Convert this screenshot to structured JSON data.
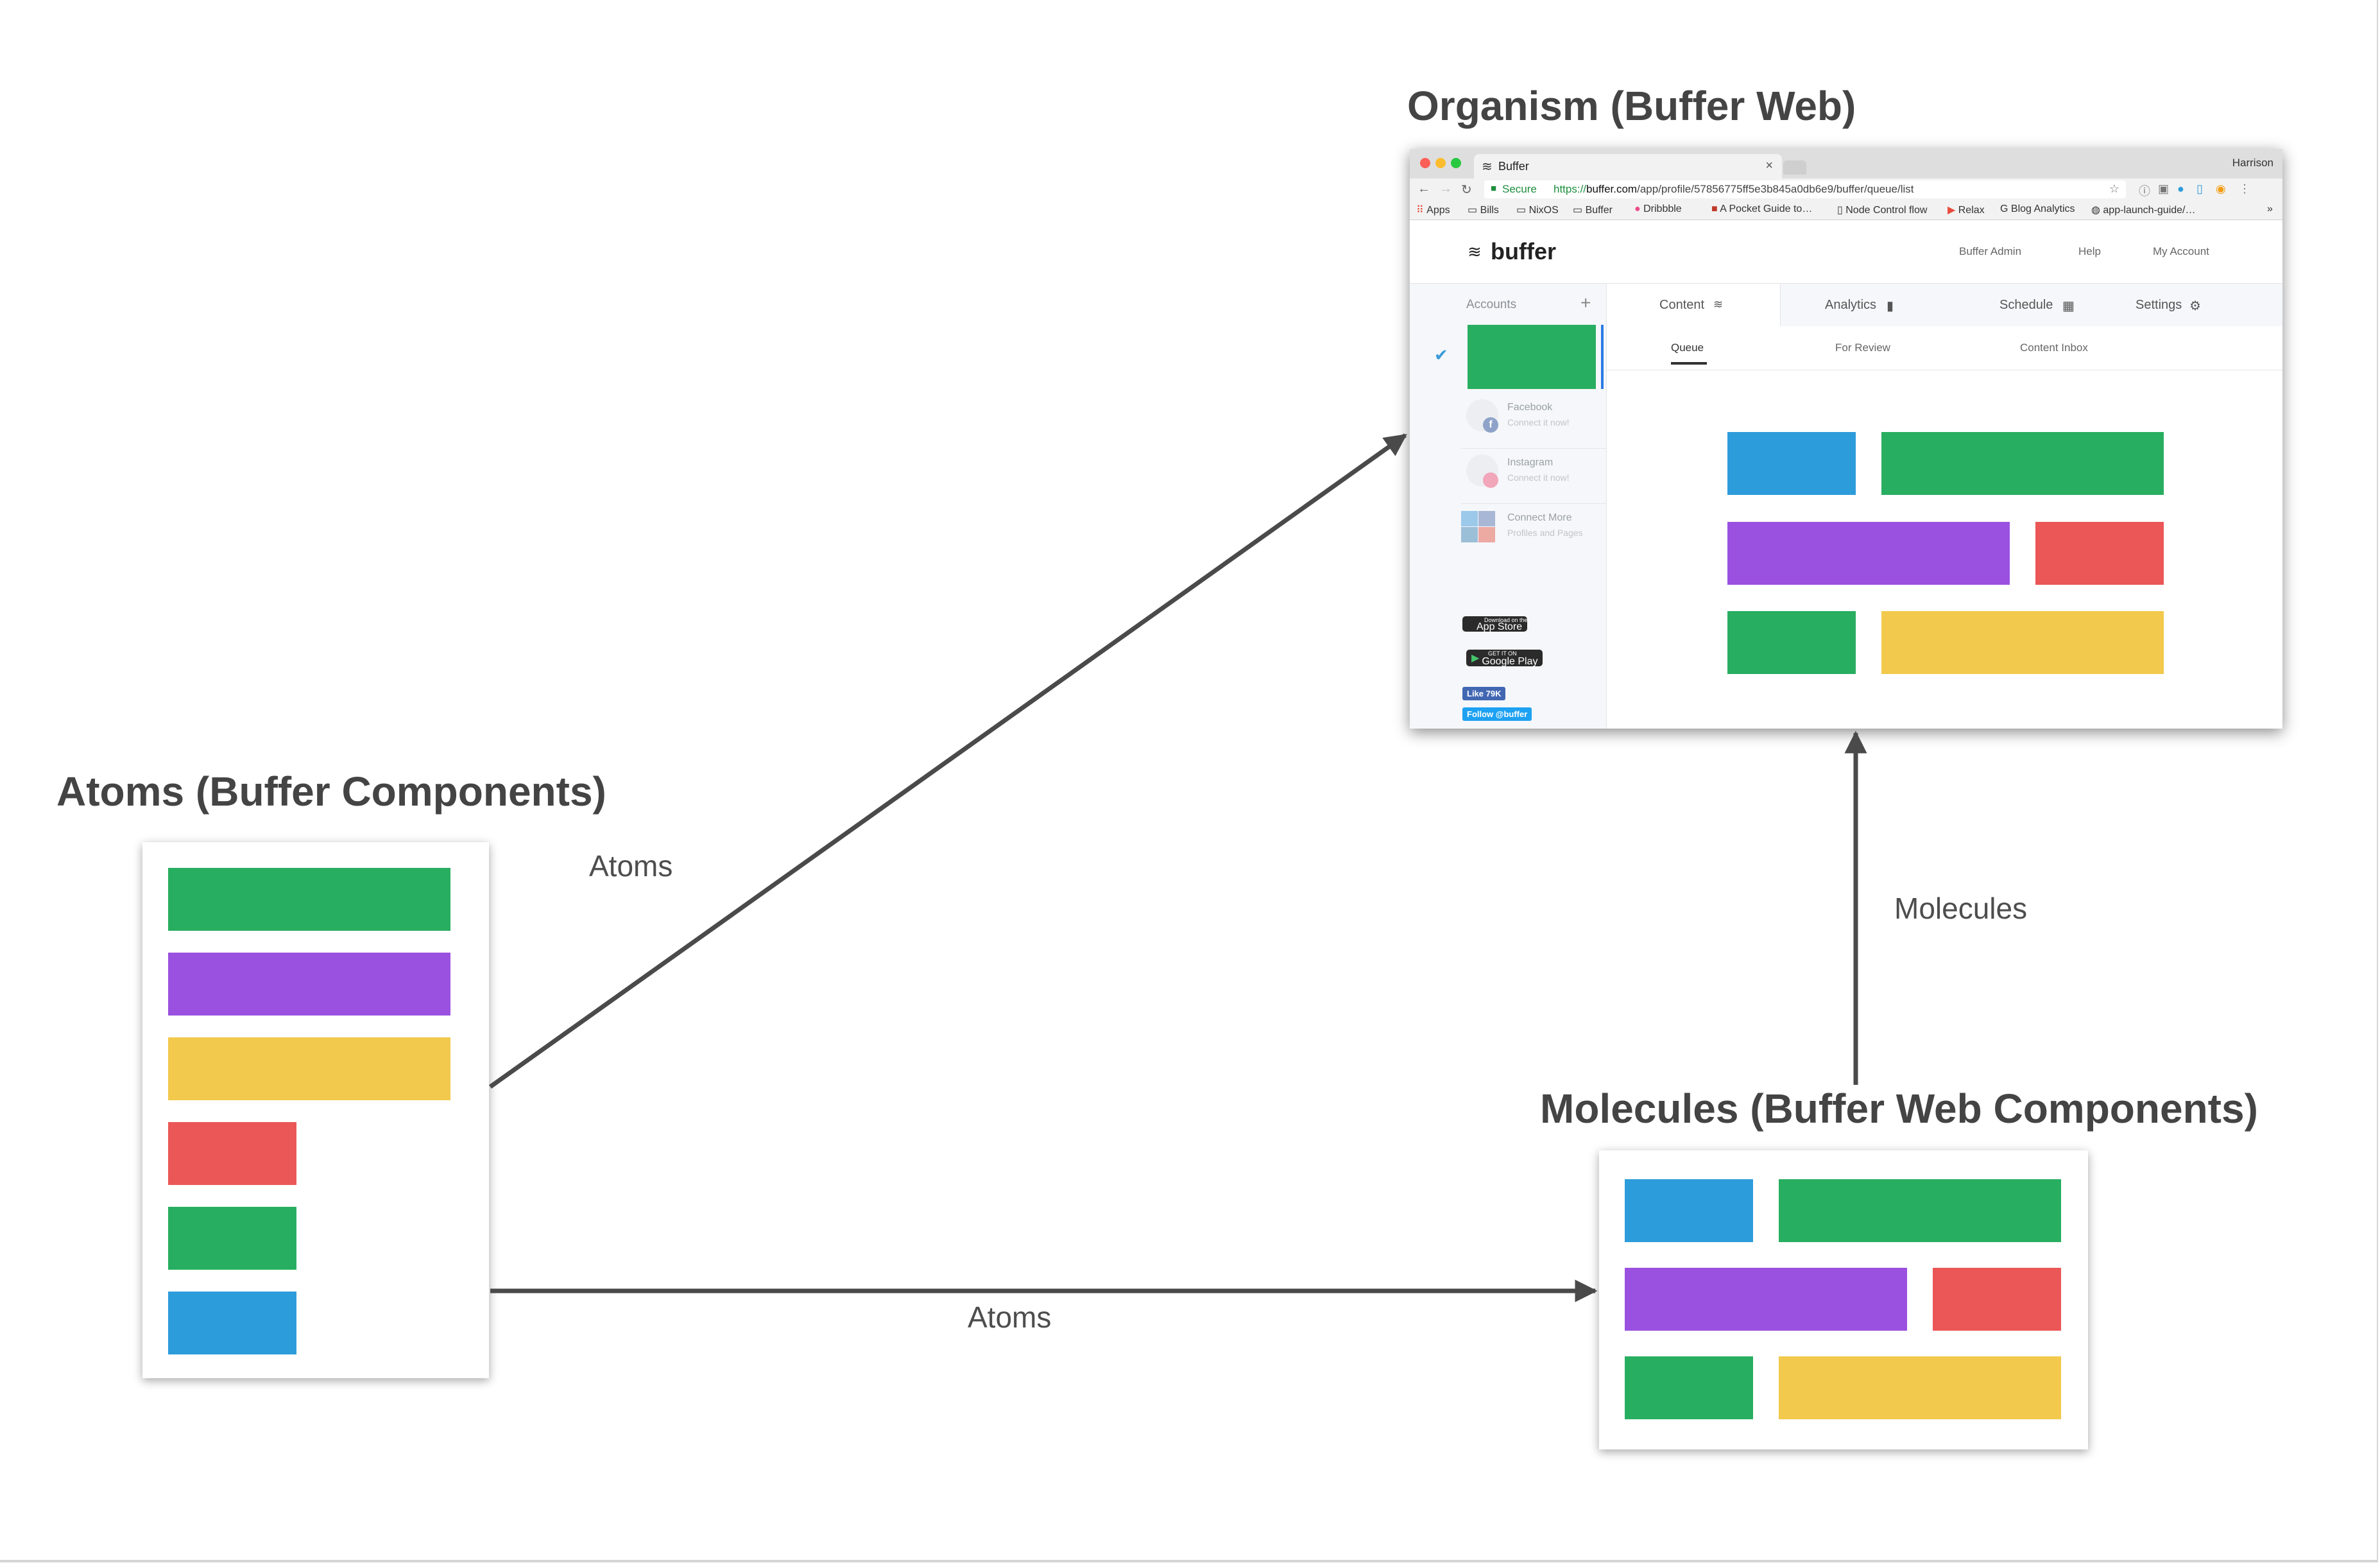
{
  "titles": {
    "atoms": "Atoms (Buffer Components)",
    "molecules": "Molecules (Buffer Web Components)",
    "organism": "Organism (Buffer Web)"
  },
  "edges": {
    "atoms_to_organism": "Atoms",
    "atoms_to_molecules": "Atoms",
    "molecules_to_organism": "Molecules"
  },
  "colors": {
    "green": "#28ae60",
    "purple": "#9b51e0",
    "yellow": "#f2c94c",
    "red": "#eb5757",
    "blue": "#2d9cdb",
    "arrow": "#4a4a4a"
  },
  "atoms_blocks": [
    "green",
    "purple",
    "yellow",
    "red",
    "green",
    "blue"
  ],
  "molecule_grid": [
    [
      "blue",
      "green"
    ],
    [
      "purple",
      "red"
    ],
    [
      "green",
      "yellow"
    ]
  ],
  "browser": {
    "tab_title": "Buffer",
    "tab_close": "×",
    "user": "Harrison",
    "secure_label": "Secure",
    "url_scheme": "https://",
    "url_host": "buffer.com",
    "url_path": "/app/profile/57856775ff5e3b845a0db6e9/buffer/queue/list",
    "bookmarks": [
      "Apps",
      "Bills",
      "NixOS",
      "Buffer",
      "Dribbble",
      "A Pocket Guide to…",
      "Node Control flow",
      "Relax",
      "Blog Analytics",
      "app-launch-guide/…"
    ],
    "bookmarks_more": "»"
  },
  "app": {
    "logo": "buffer",
    "nav": [
      "Buffer Admin",
      "Help",
      "My Account"
    ],
    "accounts_heading": "Accounts",
    "add_account": "+",
    "accounts": [
      {
        "name": "Facebook",
        "sub": "Connect it now!",
        "badge": "f"
      },
      {
        "name": "Instagram",
        "sub": "Connect it now!",
        "badge": ""
      },
      {
        "name": "Connect More",
        "sub": "Profiles and Pages",
        "badge": ""
      }
    ],
    "app_store": "App Store",
    "app_store_top": "Download on the",
    "google_play": "Google Play",
    "google_play_top": "GET IT ON",
    "fb_like": "Like 79K",
    "tw_follow": "Follow @buffer",
    "tabs": [
      "Content",
      "Analytics",
      "Schedule",
      "Settings"
    ],
    "subtabs": [
      "Queue",
      "For Review",
      "Content Inbox"
    ]
  }
}
